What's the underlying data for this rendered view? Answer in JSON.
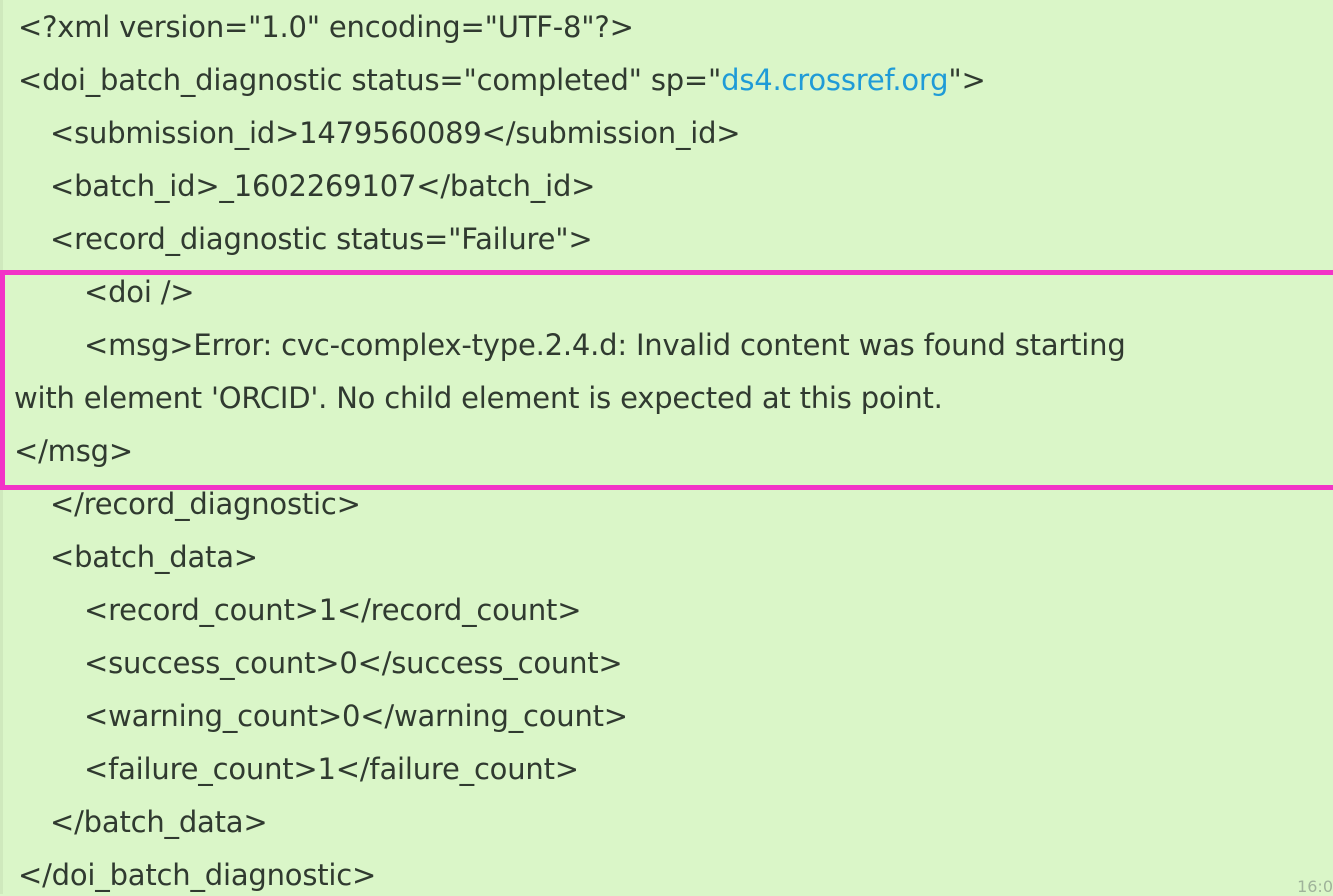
{
  "xml": {
    "declaration": "<?xml version=\"1.0\" encoding=\"UTF-8\"?>",
    "batch_open_prefix": "<doi_batch_diagnostic status=\"completed\" sp=\"",
    "service_provider": "ds4.crossref.org",
    "batch_open_suffix": "\">",
    "submission_id": "<submission_id>1479560089</submission_id>",
    "batch_id": "<batch_id>_1602269107</batch_id>",
    "record_diagnostic_open": "<record_diagnostic status=\"Failure\">",
    "doi": "<doi />",
    "msg_line_1": "<msg>Error: cvc-complex-type.2.4.d: Invalid content was found starting",
    "msg_line_2": "with element 'ORCID'. No child element is expected at this point.",
    "msg_close": "</msg>",
    "record_diagnostic_close": "</record_diagnostic>",
    "batch_data_open": "<batch_data>",
    "record_count": "<record_count>1</record_count>",
    "success_count": "<success_count>0</success_count>",
    "warning_count": "<warning_count>0</warning_count>",
    "failure_count": "<failure_count>1</failure_count>",
    "batch_data_close": "</batch_data>",
    "batch_close": "</doi_batch_diagnostic>"
  },
  "timestamp": "16:0",
  "colors": {
    "bubble_background": "#daf6c8",
    "text": "#303a30",
    "link": "#1f9bd7",
    "highlight_border": "#f234c7"
  }
}
